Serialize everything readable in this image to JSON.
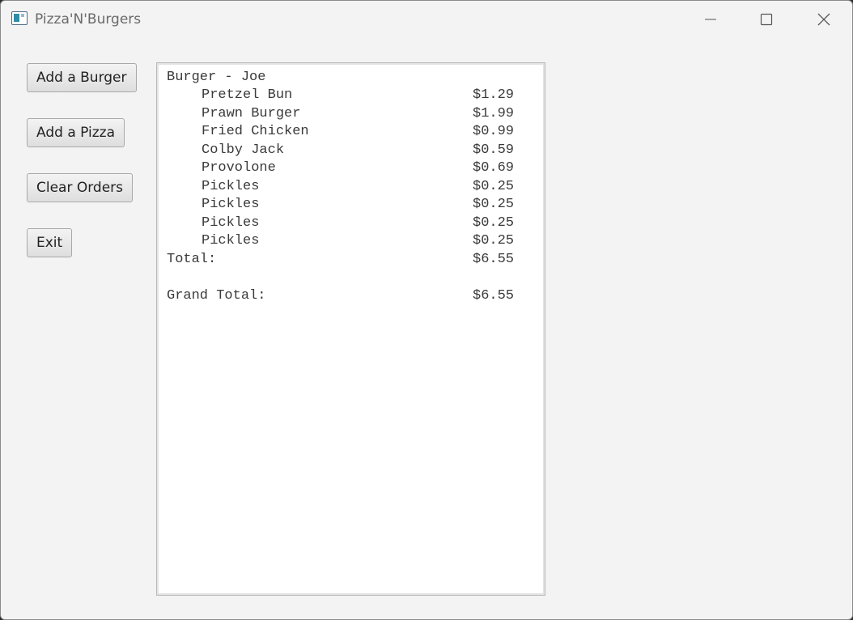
{
  "window": {
    "title": "Pizza'N'Burgers"
  },
  "buttons": {
    "add_burger": "Add a Burger",
    "add_pizza": "Add a Pizza",
    "clear_orders": "Clear Orders",
    "exit": "Exit"
  },
  "receipt": {
    "order_header": "Burger - Joe",
    "items": [
      {
        "name": "Pretzel Bun",
        "price": "$1.29"
      },
      {
        "name": "Prawn Burger",
        "price": "$1.99"
      },
      {
        "name": "Fried Chicken",
        "price": "$0.99"
      },
      {
        "name": "Colby Jack",
        "price": "$0.59"
      },
      {
        "name": "Provolone",
        "price": "$0.69"
      },
      {
        "name": "Pickles",
        "price": "$0.25"
      },
      {
        "name": "Pickles",
        "price": "$0.25"
      },
      {
        "name": "Pickles",
        "price": "$0.25"
      },
      {
        "name": "Pickles",
        "price": "$0.25"
      }
    ],
    "total_label": "Total:",
    "total_value": "$6.55",
    "grand_total_label": "Grand Total:",
    "grand_total_value": "$6.55"
  },
  "icons": {
    "app": "app-window-icon",
    "minimize": "minimize-icon",
    "maximize": "maximize-icon",
    "close": "close-icon"
  }
}
